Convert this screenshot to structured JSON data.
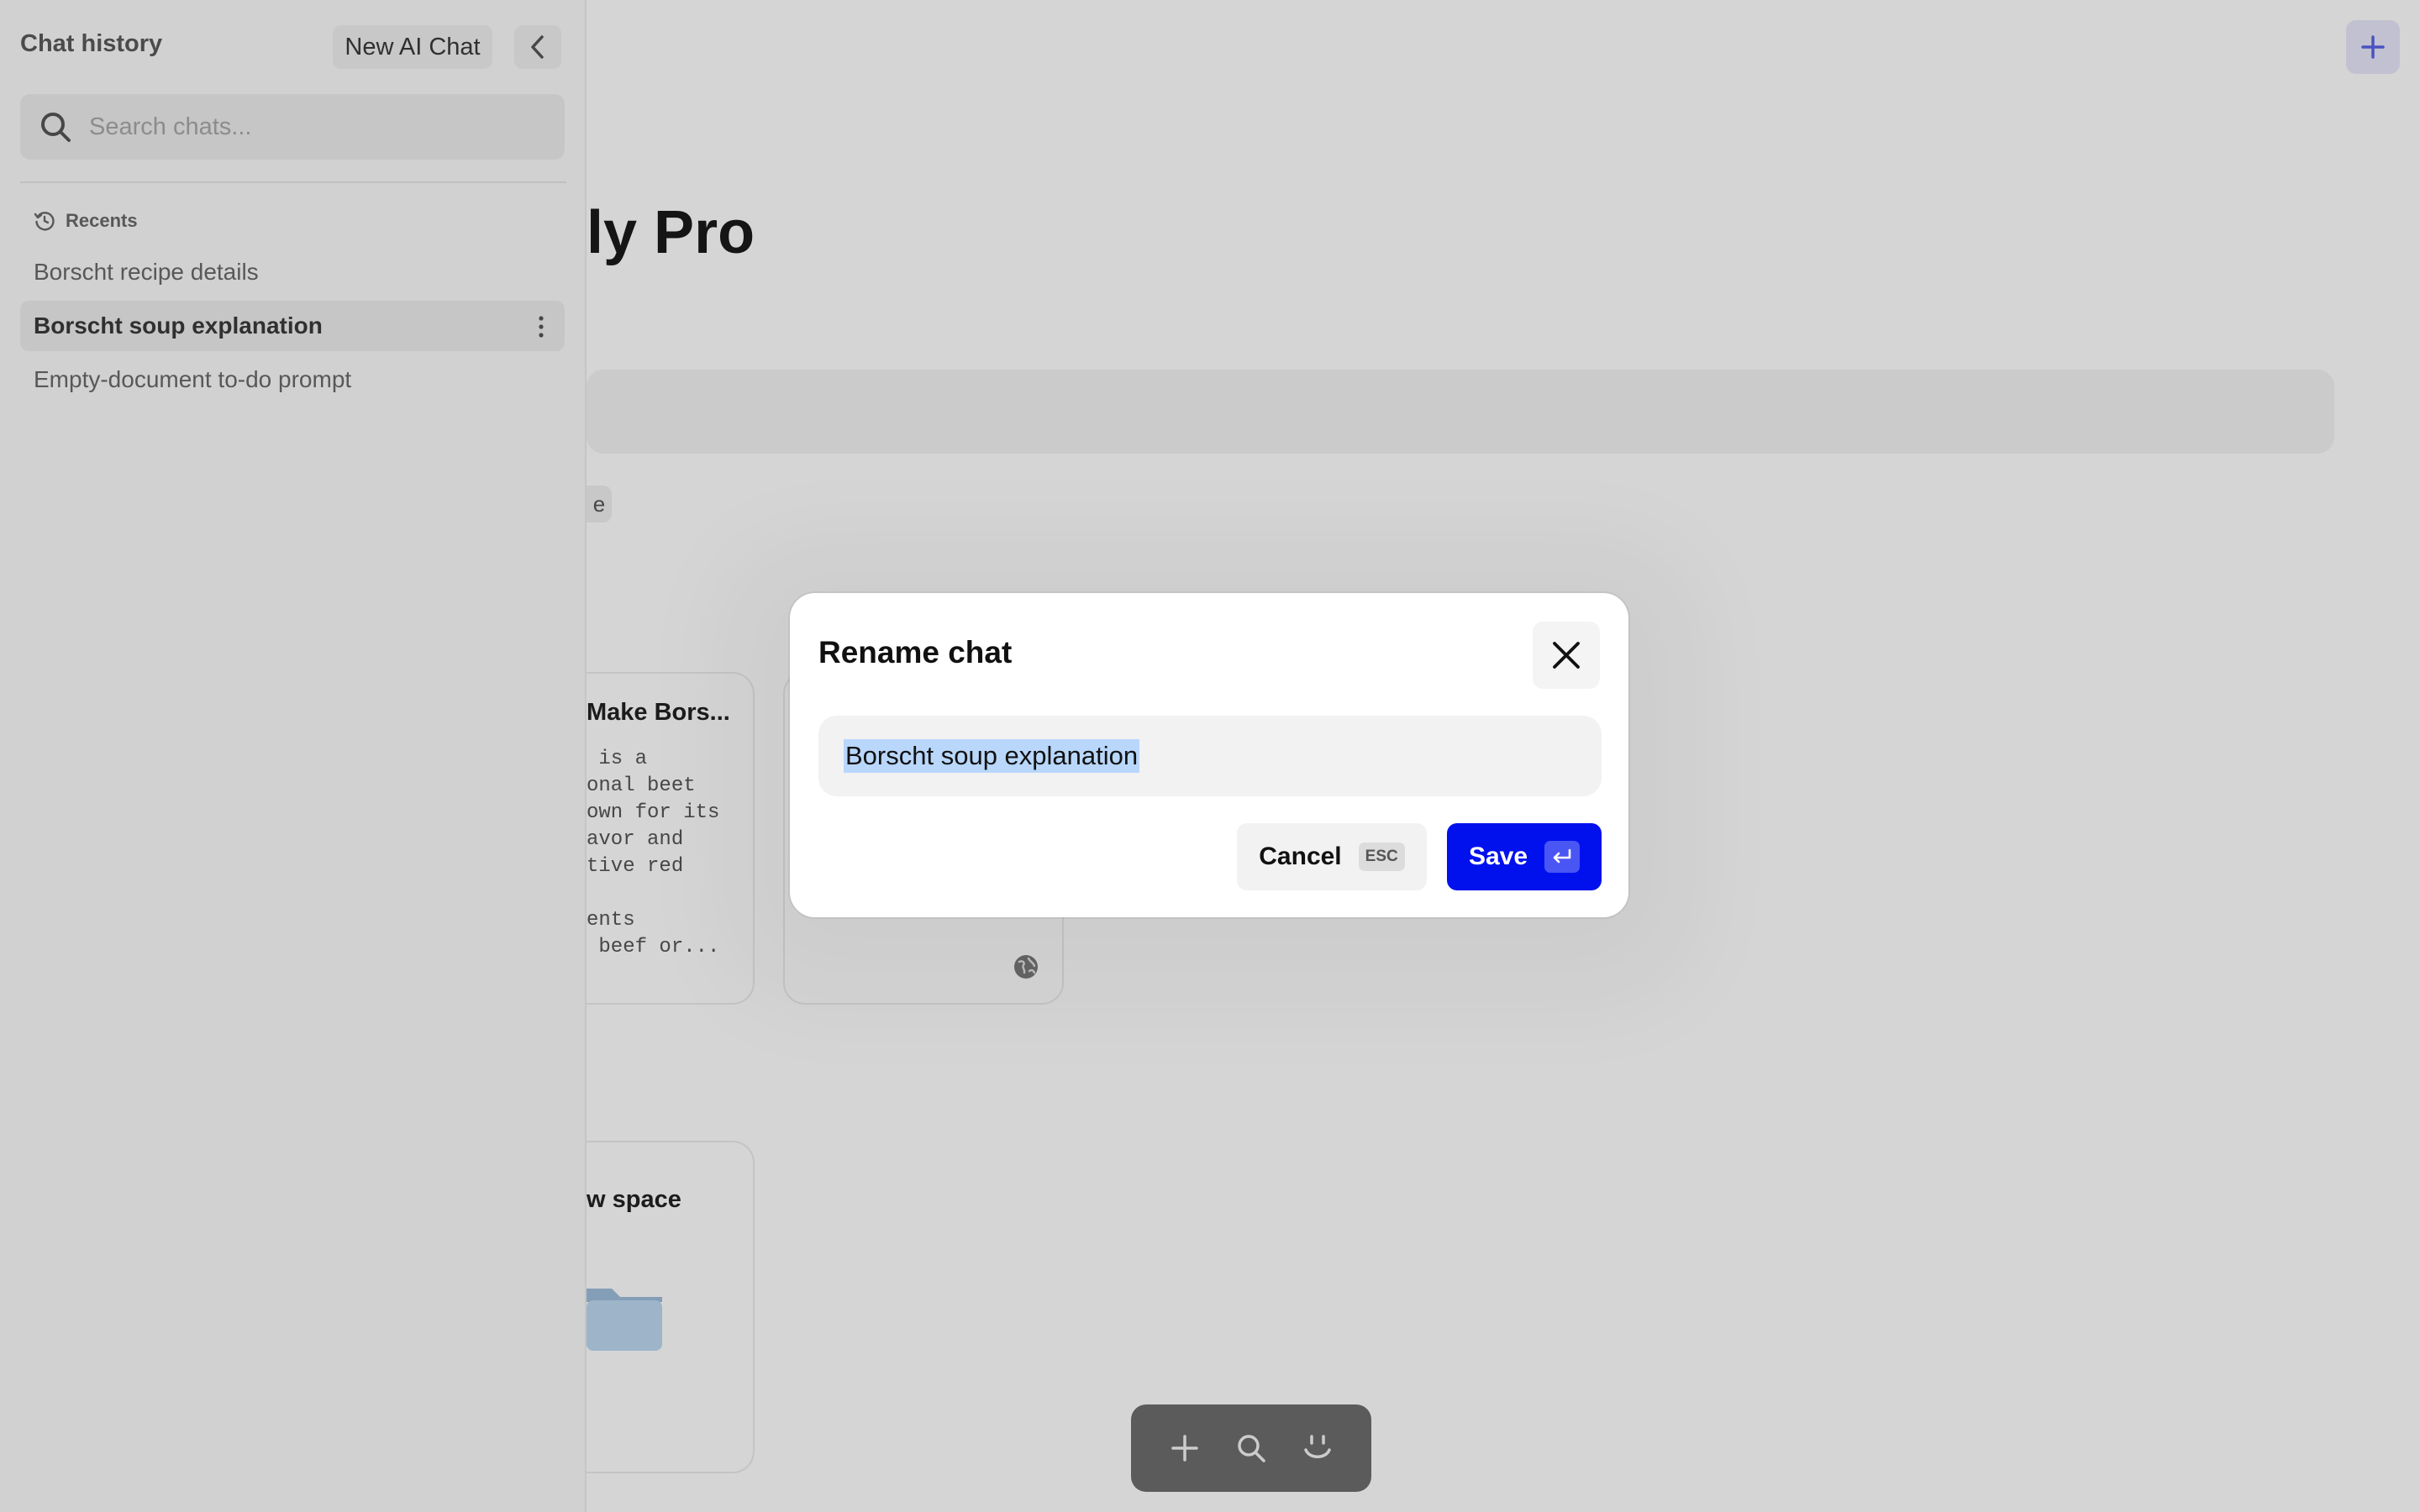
{
  "sidebar": {
    "title": "Chat history",
    "new_chat_label": "New AI Chat",
    "search_placeholder": "Search chats...",
    "recents_label": "Recents",
    "items": [
      {
        "label": "Borscht recipe details"
      },
      {
        "label": "Borscht soup explanation"
      },
      {
        "label": "Empty-document to-do prompt"
      }
    ]
  },
  "main": {
    "title": "ly Pro",
    "chip_text": "e",
    "card1": {
      "title": "Make Bors...",
      "body": " is a\nonal beet\nown for its\navor and\ntive red\n\nents\n beef or..."
    },
    "card3": {
      "title": "w space"
    }
  },
  "dialog": {
    "title": "Rename chat",
    "input_value": "Borscht soup explanation",
    "cancel_label": "Cancel",
    "cancel_shortcut": "ESC",
    "save_label": "Save"
  },
  "colors": {
    "accent": "#0011ee",
    "selection": "#b9d7fb",
    "overlay": "rgba(0,0,0,0.165)"
  },
  "icons": [
    "search-icon",
    "chevron-left-icon",
    "history-icon",
    "more-vertical-icon",
    "plus-icon",
    "globe-icon",
    "folder-icon",
    "smile-icon",
    "close-icon",
    "enter-icon"
  ]
}
